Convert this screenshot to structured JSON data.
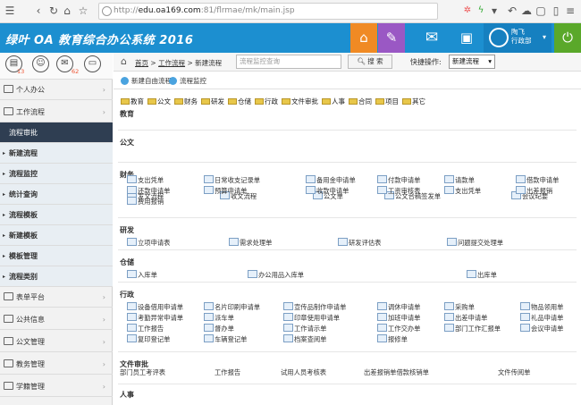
{
  "browser": {
    "url_prefix": "http://",
    "url_domain": "edu.oa169.com",
    "url_rest": ":81/flrmae/mk/main.jsp"
  },
  "header": {
    "logo": "绿叶 OA 教育综合办公系统 2016",
    "user_name": "陶飞",
    "user_dept": "行政部",
    "buttons": [
      "home-icon",
      "pen-icon",
      "mail-icon",
      "card-icon"
    ]
  },
  "sidebar": {
    "badges": [
      "13",
      "",
      "62"
    ],
    "items": [
      {
        "label": "个人办公",
        "type": "group"
      },
      {
        "label": "工作流程",
        "type": "group"
      },
      {
        "label": "流程审批",
        "type": "selected"
      },
      {
        "label": "新建流程",
        "type": "sub"
      },
      {
        "label": "流程监控",
        "type": "sub"
      },
      {
        "label": "统计查询",
        "type": "sub"
      },
      {
        "label": "流程模板",
        "type": "sub"
      },
      {
        "label": "新建模板",
        "type": "sub"
      },
      {
        "label": "模板管理",
        "type": "sub"
      },
      {
        "label": "流程类别",
        "type": "sub"
      },
      {
        "label": "表单平台",
        "type": "group"
      },
      {
        "label": "公共信息",
        "type": "group"
      },
      {
        "label": "公文管理",
        "type": "group"
      },
      {
        "label": "教务管理",
        "type": "group"
      },
      {
        "label": "学籍管理",
        "type": "group"
      }
    ]
  },
  "toolbar": {
    "crumb_home": "首页",
    "crumb_flow": "工作流程",
    "crumb_current": "新建流程",
    "search_placeholder": "流程监控查询",
    "search_button": "搜 索",
    "quick_label": "快捷操作:",
    "quick_value": "新建流程"
  },
  "actions": {
    "free_flow": "新建自由流程",
    "monitor": "流程监控"
  },
  "categories": [
    "教育",
    "公文",
    "财务",
    "研发",
    "仓储",
    "行政",
    "文件审批",
    "人事",
    "合同",
    "项目",
    "其它"
  ],
  "sections": [
    {
      "title": "教育",
      "items": []
    },
    {
      "title": "公文",
      "items": [
        "发文流程",
        "收文流程",
        "公文单",
        "公文合稿签发单",
        "会议纪要"
      ]
    },
    {
      "title": "财务",
      "items": [
        "支出凭单",
        "日常收支记录单",
        "备用金申请单",
        "付款申请单",
        "请款单",
        "借款申请单",
        "还款申请单",
        "预算申请单",
        "收款申请单",
        "工资审核表",
        "支出凭单",
        "出差报销",
        "费用报销"
      ]
    },
    {
      "title": "研发",
      "items": [
        "立项申请表",
        "需求处理单",
        "研发评估表",
        "问题提交处理单"
      ]
    },
    {
      "title": "仓储",
      "items": [
        "入库单",
        "办公用品入库单",
        "出库单"
      ]
    },
    {
      "title": "行政",
      "items": [
        "设备借用申请单",
        "名片印刷申请单",
        "宣传品制作申请单",
        "调休申请单",
        "采购单",
        "物品领用单",
        "考勤异常申请单",
        "派车单",
        "印章使用申请单",
        "加班申请单",
        "出差申请单",
        "礼品申请单",
        "工作报告",
        "督办单",
        "工作请示单",
        "工作交办单",
        "部门工作汇报单",
        "会议申请单",
        "复印登记单",
        "车辆登记单",
        "档案查阅单",
        "报修单"
      ]
    },
    {
      "title": "文件审批",
      "items": [
        "部门员工考评表",
        "工作报告",
        "试用人员考核表",
        "出差报销单借款核销单",
        "文件传阅单"
      ]
    },
    {
      "title": "人事",
      "items": []
    }
  ]
}
